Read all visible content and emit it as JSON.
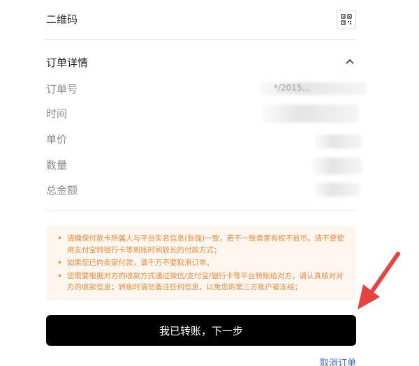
{
  "qr": {
    "label": "二维码"
  },
  "order_details": {
    "title": "订单详情",
    "fields": [
      {
        "label": "订单号",
        "value": "*/2015..."
      },
      {
        "label": "时间",
        "value": ""
      },
      {
        "label": "单价",
        "value": ""
      },
      {
        "label": "数量",
        "value": ""
      },
      {
        "label": "总金额",
        "value": ""
      }
    ]
  },
  "notice": {
    "items": [
      "请确保付款卡所属人与平台实名信息(张强)一致，若不一致卖家有权不放币。请不要使用支付宝转银行卡等到账时间较长的付款方式；",
      "如果您已向卖家付款，请千万不要取消订单。",
      "您需要根据对方的收款方式通过微信/支付宝/银行卡等平台转账给对方，请认真核对对方的收款信息；转账时请勿备注任何信息，以免您的第三方账户被冻结；"
    ]
  },
  "actions": {
    "confirm_label": "我已转账，下一步",
    "cancel_label": "取消订单"
  },
  "colors": {
    "primary_button": "#000000",
    "notice_bg": "#fff7ef",
    "notice_text": "#f08a3c",
    "link": "#2b6bd6",
    "annotation_arrow": "#e8423f"
  }
}
